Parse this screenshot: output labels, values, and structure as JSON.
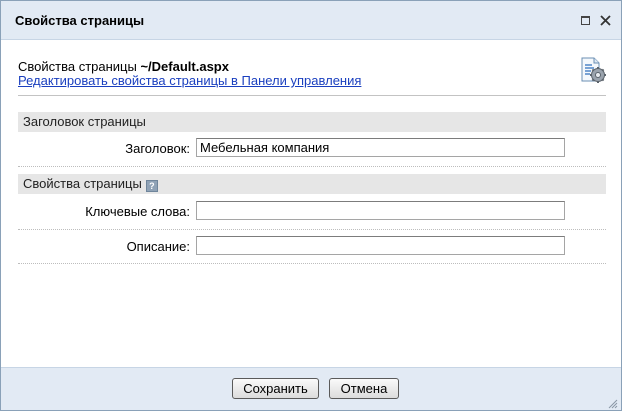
{
  "dialog": {
    "title": "Свойства страницы",
    "controls": {
      "maximize_icon": "maximize-icon",
      "close_icon": "close-icon"
    }
  },
  "page_info": {
    "prefix": "Свойства страницы",
    "path": "~/Default.aspx",
    "manage_link": "Редактировать свойства страницы в Панели управления",
    "icon": "page-settings-icon"
  },
  "sections": {
    "title_section": {
      "header": "Заголовок страницы",
      "fields": [
        {
          "label": "Заголовок:",
          "value": "Мебельная компания"
        }
      ]
    },
    "properties_section": {
      "header": "Свойства страницы",
      "help_icon": "help-icon",
      "fields": [
        {
          "label": "Ключевые слова:",
          "value": ""
        },
        {
          "label": "Описание:",
          "value": ""
        }
      ]
    }
  },
  "footer": {
    "save_label": "Сохранить",
    "cancel_label": "Отмена"
  },
  "colors": {
    "titlebar_bg": "#e2eaf4",
    "link": "#1a3fbf",
    "section_bg": "#e6e6e6"
  }
}
